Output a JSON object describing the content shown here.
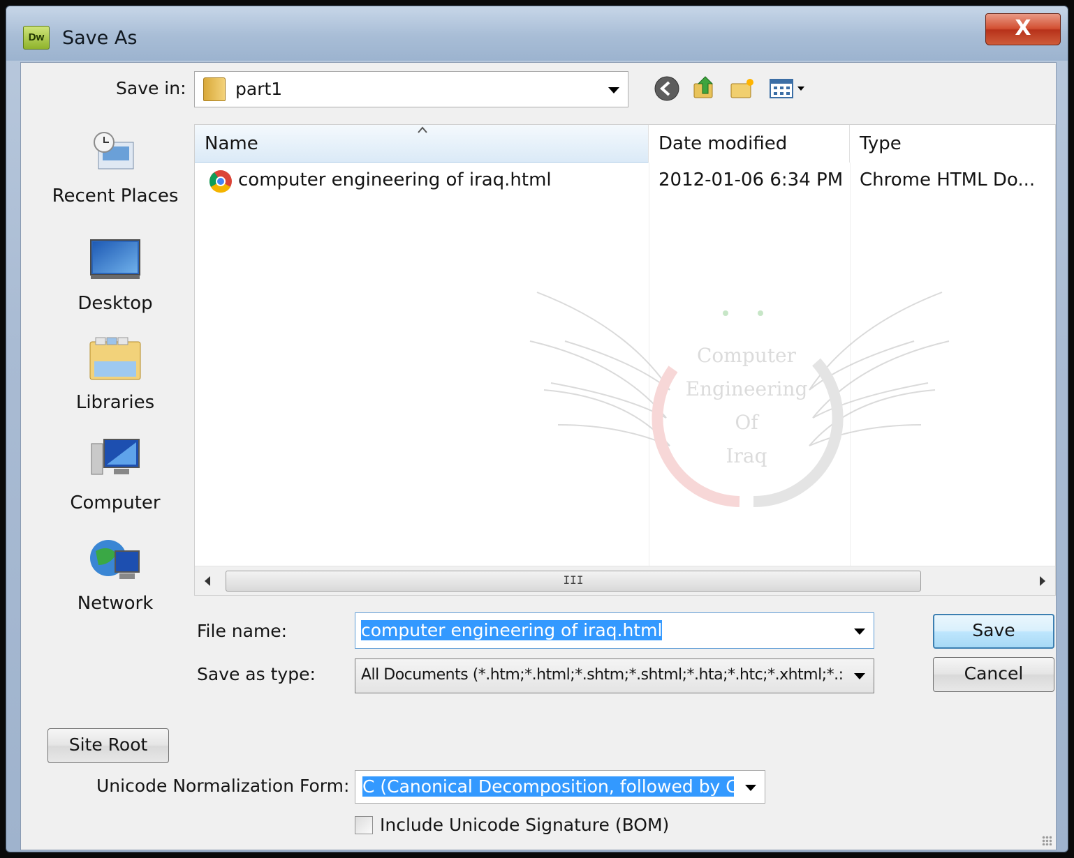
{
  "window": {
    "app_icon_text": "Dw",
    "title": "Save As",
    "close_glyph": "X"
  },
  "toolbar": {
    "save_in_label": "Save in:",
    "save_in_value": "part1",
    "icons": [
      "back-arrow-icon",
      "up-folder-icon",
      "new-folder-icon",
      "view-menu-icon"
    ]
  },
  "places": [
    {
      "label": "Recent Places",
      "icon": "recent-places-icon"
    },
    {
      "label": "Desktop",
      "icon": "desktop-icon"
    },
    {
      "label": "Libraries",
      "icon": "libraries-icon"
    },
    {
      "label": "Computer",
      "icon": "computer-icon"
    },
    {
      "label": "Network",
      "icon": "network-icon"
    }
  ],
  "filelist": {
    "columns": [
      "Name",
      "Date modified",
      "Type"
    ],
    "rows": [
      {
        "name": "computer engineering of iraq.html",
        "date": "2012-01-06 6:34 PM",
        "type": "Chrome HTML Do...",
        "icon": "chrome-icon"
      }
    ],
    "watermark_text": [
      "Computer",
      "Engineering",
      "Of",
      "Iraq"
    ],
    "scroll_thumb_glyph": "III"
  },
  "form": {
    "file_name_label": "File name:",
    "file_name_value": "computer engineering of iraq.html",
    "save_as_type_label": "Save as type:",
    "save_as_type_value": "All Documents (*.htm;*.html;*.shtm;*.shtml;*.hta;*.htc;*.xhtml;*.:",
    "save_button": "Save",
    "cancel_button": "Cancel",
    "site_root_button": "Site Root",
    "unicode_label": "Unicode Normalization Form:",
    "unicode_value": "C (Canonical Decomposition, followed by Canc",
    "bom_label": "Include Unicode Signature (BOM)",
    "bom_checked": false
  },
  "colors": {
    "selection": "#3399ff",
    "default_button_border": "#3c7fb1",
    "close_button": "#c94426"
  }
}
